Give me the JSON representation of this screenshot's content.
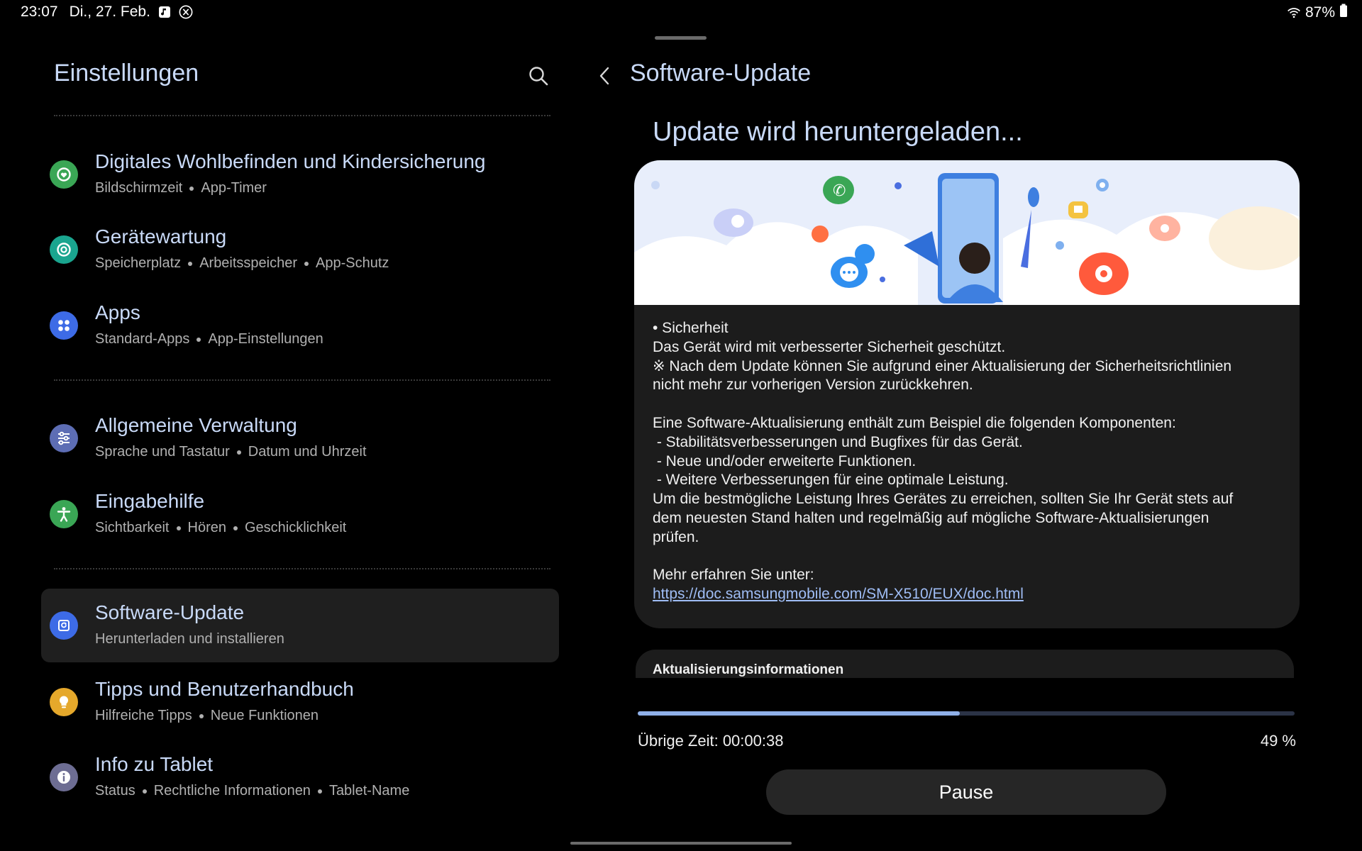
{
  "status_bar": {
    "time": "23:07",
    "date": "Di., 27. Feb.",
    "battery": "87%",
    "icons": [
      "music-note-icon",
      "x-logo-icon",
      "wifi-icon",
      "battery-icon"
    ]
  },
  "left_panel": {
    "title": "Einstellungen",
    "items": [
      {
        "title": "Digitales Wohlbefinden und Kindersicherung",
        "sub": [
          "Bildschirmzeit",
          "App-Timer"
        ],
        "icon": "heart-shield-icon",
        "color": "#3aa655"
      },
      {
        "title": "Gerätewartung",
        "sub": [
          "Speicherplatz",
          "Arbeitsspeicher",
          "App-Schutz"
        ],
        "icon": "device-care-icon",
        "color": "#1aa58f"
      },
      {
        "title": "Apps",
        "sub": [
          "Standard-Apps",
          "App-Einstellungen"
        ],
        "icon": "apps-grid-icon",
        "color": "#3d6be6"
      },
      {
        "title": "Allgemeine Verwaltung",
        "sub": [
          "Sprache und Tastatur",
          "Datum und Uhrzeit"
        ],
        "icon": "sliders-icon",
        "color": "#5d6db4"
      },
      {
        "title": "Eingabehilfe",
        "sub": [
          "Sichtbarkeit",
          "Hören",
          "Geschicklichkeit"
        ],
        "icon": "accessibility-icon",
        "color": "#3aa655"
      },
      {
        "title": "Software-Update",
        "sub": [
          "Herunterladen und installieren"
        ],
        "icon": "software-update-icon",
        "color": "#3d6be6"
      },
      {
        "title": "Tipps und Benutzerhandbuch",
        "sub": [
          "Hilfreiche Tipps",
          "Neue Funktionen"
        ],
        "icon": "lightbulb-icon",
        "color": "#e5a82b"
      },
      {
        "title": "Info zu Tablet",
        "sub": [
          "Status",
          "Rechtliche Informationen",
          "Tablet-Name"
        ],
        "icon": "info-icon",
        "color": "#6d6d93"
      }
    ]
  },
  "right_panel": {
    "title": "Software-Update",
    "headline": "Update wird heruntergeladen...",
    "notes": "• Sicherheit\nDas Gerät wird mit verbesserter Sicherheit geschützt.\n※ Nach dem Update können Sie aufgrund einer Aktualisierung der Sicherheitsrichtlinien\nnicht mehr zur vorherigen Version zurückkehren.\n\nEine Software-Aktualisierung enthält zum Beispiel die folgenden Komponenten:\n - Stabilitätsverbesserungen und Bugfixes für das Gerät.\n - Neue und/oder erweiterte Funktionen.\n - Weitere Verbesserungen für eine optimale Leistung.\nUm die bestmögliche Leistung Ihres Gerätes zu erreichen, sollten Sie Ihr Gerät stets auf\ndem neuesten Stand halten und regelmäßig auf mögliche Software-Aktualisierungen\nprüfen.\n\nMehr erfahren Sie unter:",
    "link": "https://doc.samsungmobile.com/SM-X510/EUX/doc.html",
    "info_label": "Aktualisierungsinformationen",
    "progress": 0.49,
    "remaining": "Übrige Zeit: 00:00:38",
    "percent": "49 %",
    "pause_label": "Pause"
  }
}
